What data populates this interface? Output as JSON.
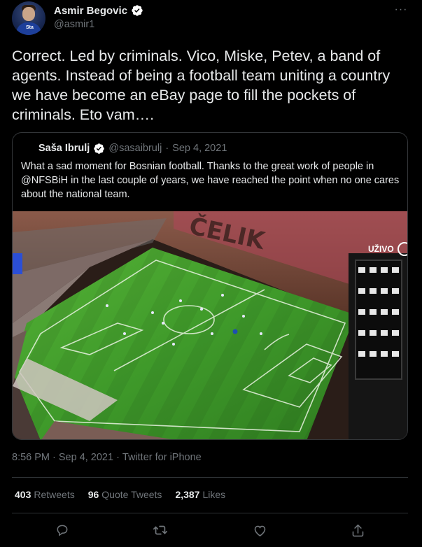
{
  "author": {
    "display_name": "Asmir Begovic",
    "handle": "@asmir1",
    "verified": true,
    "avatar_crest": "Sta"
  },
  "tweet": {
    "text": "Correct. Led by criminals. Vico, Miske, Petev, a band of agents. Instead of being a football team uniting a country we have become an eBay page to fill the pockets of criminals. Eto vam…."
  },
  "quote": {
    "display_name": "Saša Ibrulj",
    "handle": "@sasaibrulj",
    "separator": "·",
    "date": "Sep 4, 2021",
    "text": "What a sad moment for Bosnian football. Thanks to the great work of people in @NFSBiH in the last couple of years, we have reached the point when no one cares about the national team.",
    "media": {
      "overlay_text": "UŽIVO",
      "stadium_letters": "ČELIK"
    }
  },
  "meta": {
    "time": "8:56 PM",
    "separator1": "·",
    "date": "Sep 4, 2021",
    "separator2": "·",
    "source": "Twitter for iPhone"
  },
  "stats": {
    "retweets_count": "403",
    "retweets_label": "Retweets",
    "quotes_count": "96",
    "quotes_label": "Quote Tweets",
    "likes_count": "2,387",
    "likes_label": "Likes"
  },
  "more_label": "···",
  "colors": {
    "background": "#000000",
    "text_primary": "#e7e9ea",
    "text_secondary": "#71767b",
    "border": "#2f3336",
    "verified": "#ffffff",
    "pitch": "#3f9a2a"
  },
  "icons": [
    "verified-badge-icon",
    "more-icon",
    "reply-icon",
    "retweet-icon",
    "like-icon",
    "share-icon"
  ]
}
